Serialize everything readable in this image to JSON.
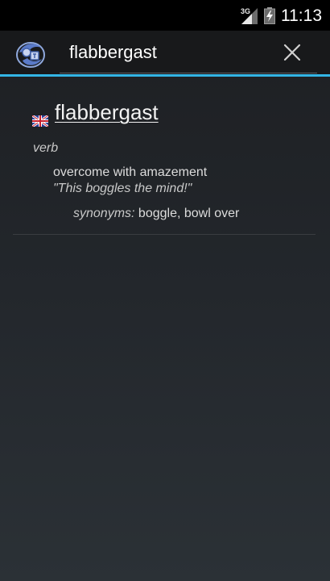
{
  "status_bar": {
    "network": "3G",
    "time": "11:13"
  },
  "action_bar": {
    "app_icon": "dictionary-app-icon",
    "search": {
      "value": "flabbergast",
      "placeholder": ""
    },
    "clear_icon": "close-icon",
    "accent_color": "#33b5e5"
  },
  "entry": {
    "flag_icon": "uk-flag-icon",
    "headword": "flabbergast",
    "part_of_speech": "verb",
    "definition": "overcome with amazement",
    "example": "\"This boggles the mind!\"",
    "synonyms_label": "synonyms:",
    "synonyms": "boggle, bowl over"
  }
}
